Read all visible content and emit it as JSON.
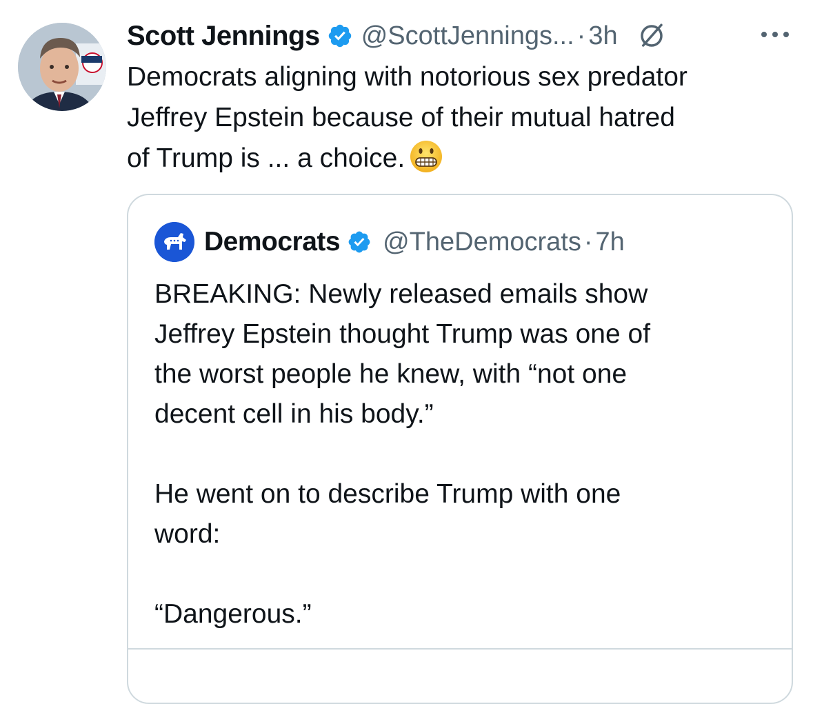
{
  "tweet": {
    "author": {
      "display_name": "Scott Jennings",
      "handle": "@ScottJennings...",
      "verified": true,
      "avatar_icon": "avatar-photo-icon"
    },
    "separator": "·",
    "time": "3h",
    "text_lines": [
      "Democrats aligning with notorious sex predator",
      "Jeffrey Epstein because of their mutual hatred",
      "of Trump is ... a choice."
    ],
    "emoji": "grimacing-face-emoji",
    "icons": {
      "verified": "verified-badge-icon",
      "grok": "grok-icon",
      "more": "more-options-icon"
    }
  },
  "quoted_tweet": {
    "author": {
      "display_name": "Democrats",
      "handle": "@TheDemocrats",
      "verified": true,
      "avatar_icon": "democratic-donkey-logo-icon"
    },
    "separator": "·",
    "time": "7h",
    "text_lines": [
      "BREAKING: Newly released emails show",
      "Jeffrey Epstein thought Trump was one of",
      "the worst people he knew, with “not one",
      "decent cell in his body.”",
      "",
      "He went on to describe Trump with one",
      "word:",
      "",
      "“Dangerous.”"
    ]
  },
  "colors": {
    "text_primary": "#0f1419",
    "text_secondary": "#536471",
    "verified_blue": "#1d9bf0",
    "border": "#cfd9de",
    "democrats_blue": "#1a56d6"
  }
}
